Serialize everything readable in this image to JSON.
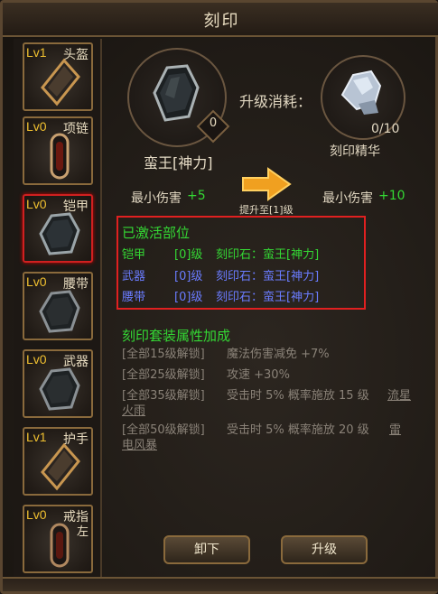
{
  "title": "刻印",
  "slots": [
    {
      "level": "Lv1",
      "part": "头盔",
      "part2": ""
    },
    {
      "level": "Lv0",
      "part": "项链",
      "part2": ""
    },
    {
      "level": "Lv0",
      "part": "铠甲",
      "part2": ""
    },
    {
      "level": "Lv0",
      "part": "腰带",
      "part2": ""
    },
    {
      "level": "Lv0",
      "part": "武器",
      "part2": ""
    },
    {
      "level": "Lv1",
      "part": "护手",
      "part2": ""
    },
    {
      "level": "Lv0",
      "part": "戒指",
      "part2": "左"
    }
  ],
  "gem": {
    "name": "蛮王[神力]",
    "level": "0"
  },
  "cost": {
    "label": "升级消耗：",
    "item_name": "刻印精华",
    "count": "0/10"
  },
  "stats": {
    "current": "最小伤害",
    "current_val": "+5",
    "arrow_label": "提升至[1]级",
    "next": "最小伤害",
    "next_val": "+10"
  },
  "activated": {
    "header": "已激活部位",
    "rows": [
      {
        "part": "铠甲",
        "level": "[0]级",
        "stone": "刻印石：蛮王[神力]",
        "active": true
      },
      {
        "part": "武器",
        "level": "[0]级",
        "stone": "刻印石：蛮王[神力]",
        "active": false
      },
      {
        "part": "腰带",
        "level": "[0]级",
        "stone": "刻印石：蛮王[神力]",
        "active": false
      }
    ]
  },
  "set_bonus": {
    "header": "刻印套装属性加成",
    "items": [
      {
        "req": "[全部15级解锁]",
        "desc": "魔法伤害减免 +7%"
      },
      {
        "req": "[全部25级解锁]",
        "desc": "攻速 +30%"
      },
      {
        "req": "[全部35级解锁]",
        "desc": "受击时 5% 概率施放 15 级",
        "link1": "流星",
        "link2": "火雨"
      },
      {
        "req": "[全部50级解锁]",
        "desc": "受击时 5% 概率施放 20 级",
        "link1": "雷",
        "link2": "电风暴"
      }
    ]
  },
  "buttons": {
    "unequip": "卸下",
    "upgrade": "升级"
  }
}
